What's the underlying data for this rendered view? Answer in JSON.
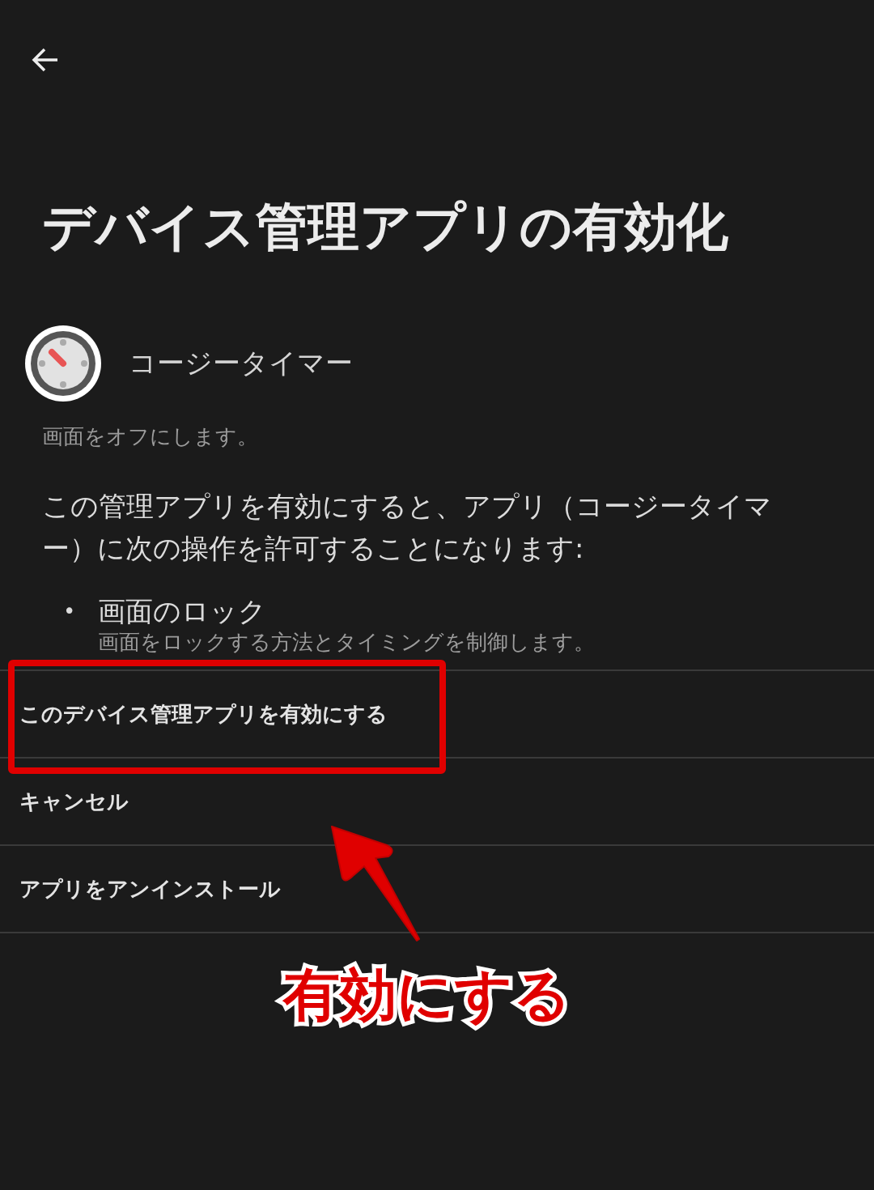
{
  "title": "デバイス管理アプリの有効化",
  "app": {
    "name": "コージータイマー",
    "description": "画面をオフにします。"
  },
  "intro": "この管理アプリを有効にすると、アプリ（コージータイマー）に次の操作を許可することになります:",
  "permissions": [
    {
      "bullet": "•",
      "title": "画面のロック",
      "detail": "画面をロックする方法とタイミングを制御します。"
    }
  ],
  "actions": [
    {
      "label": "このデバイス管理アプリを有効にする",
      "highlighted": true
    },
    {
      "label": "キャンセル",
      "highlighted": false
    },
    {
      "label": "アプリをアンインストール",
      "highlighted": false
    }
  ],
  "annotation": {
    "label": "有効にする"
  }
}
